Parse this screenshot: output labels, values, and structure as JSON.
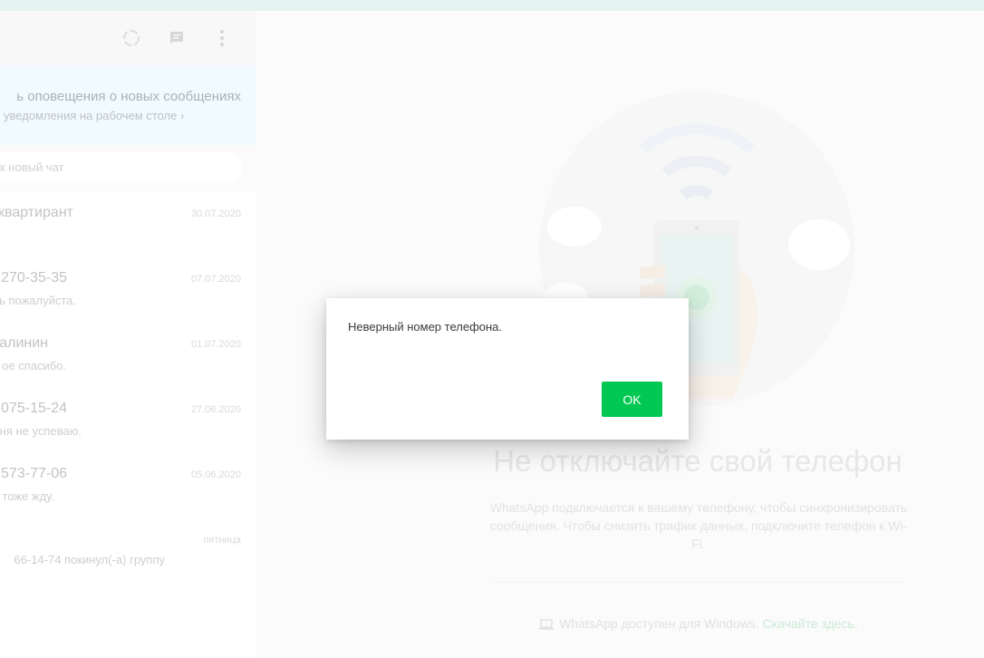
{
  "left_pane": {
    "notification": {
      "title": "ь оповещения о новых сообщениях",
      "subtitle": " уведомления на рабочем столе ›"
    },
    "search": {
      "placeholder": "к новый чат"
    },
    "chats": [
      {
        "name": "квартирант",
        "time": "30.07.2020",
        "preview": ""
      },
      {
        "name": "270-35-35",
        "time": "07.07.2020",
        "preview": "ь пожалуйста."
      },
      {
        "name": "алинин",
        "time": "01.07.2020",
        "preview": "ое спасибо."
      },
      {
        "name": "075-15-24",
        "time": "27.06.2020",
        "preview": "ня не успеваю."
      },
      {
        "name": "573-77-06",
        "time": "05.06.2020",
        "preview": "тоже жду."
      },
      {
        "name": "",
        "time": "пятница",
        "preview": "66-14-74 покинул(-а) группу"
      }
    ]
  },
  "right_pane": {
    "title": "Не отключайте свой телефон",
    "text": "WhatsApp подключается к вашему телефону, чтобы синхронизировать сообщения. Чтобы снизить трафик данных, подключите телефон к Wi-Fi.",
    "windows_text": "WhatsApp доступен для Windows.",
    "windows_link": "Скачайте здесь."
  },
  "dialog": {
    "message": "Неверный номер телефона.",
    "ok_label": "OK"
  },
  "colors": {
    "accent_green": "#00c853",
    "notification_bg": "#eefaff",
    "top_strip": "#dff0ee"
  },
  "icons": [
    "status-icon",
    "new-chat-icon",
    "menu-icon",
    "laptop-icon"
  ]
}
